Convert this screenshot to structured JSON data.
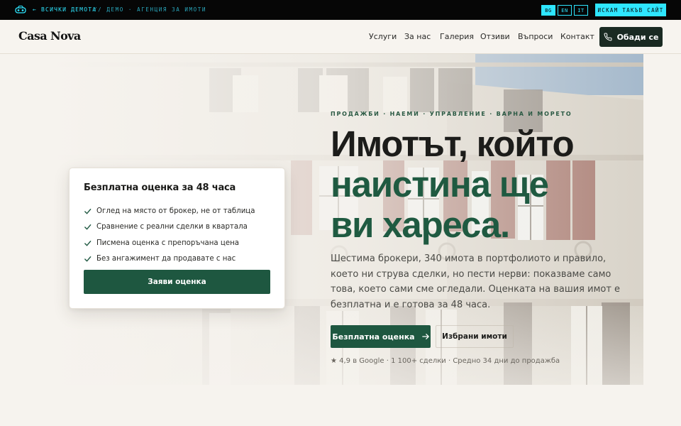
{
  "demo_bar": {
    "back_link": "← ВСИЧКИ ДЕМОТА",
    "label": "// ДЕМО · АГЕНЦИЯ ЗА ИМОТИ",
    "languages": [
      {
        "code": "BG",
        "active": true
      },
      {
        "code": "EN",
        "active": false
      },
      {
        "code": "IT",
        "active": false
      }
    ],
    "cta": "ИСКАМ ТАКЪВ САЙТ",
    "accent": "#2ee6ff"
  },
  "header": {
    "brand": "Casa Nova",
    "nav": [
      "Услуги",
      "За нас",
      "Галерия",
      "Отзиви",
      "Въпроси",
      "Контакт"
    ],
    "call_button": "Обади се",
    "call_icon": "phone-icon"
  },
  "hero": {
    "eyebrow": "ПРОДАЖБИ · НАЕМИ · УПРАВЛЕНИЕ · ВАРНА И МОРЕТО",
    "headline": [
      "Имотът, който",
      "наистина ще",
      "ви хареса."
    ],
    "lede": "Шестима брокери, 340 имота в портфолиото и правило, което ни струва сделки, но пести нерви: показваме само това, което сами сме огледали. Оценката на вашия имот е безплатна и е готова за 48 часа.",
    "primary_button": "Безплатна оценка",
    "secondary_button": "Избрани имоти",
    "proof": "★ 4,9 в Google · 1 100+ сделки · Средно 34 дни до продажба",
    "brand_green": "#1e5740"
  },
  "card": {
    "title": "Безплатна оценка за 48 часа",
    "items": [
      "Оглед на място от брокер, не от таблица",
      "Сравнение с реални сделки в квартала",
      "Писмена оценка с препоръчана цена",
      "Без ангажимент да продавате с нас"
    ],
    "button": "Заяви оценка"
  }
}
